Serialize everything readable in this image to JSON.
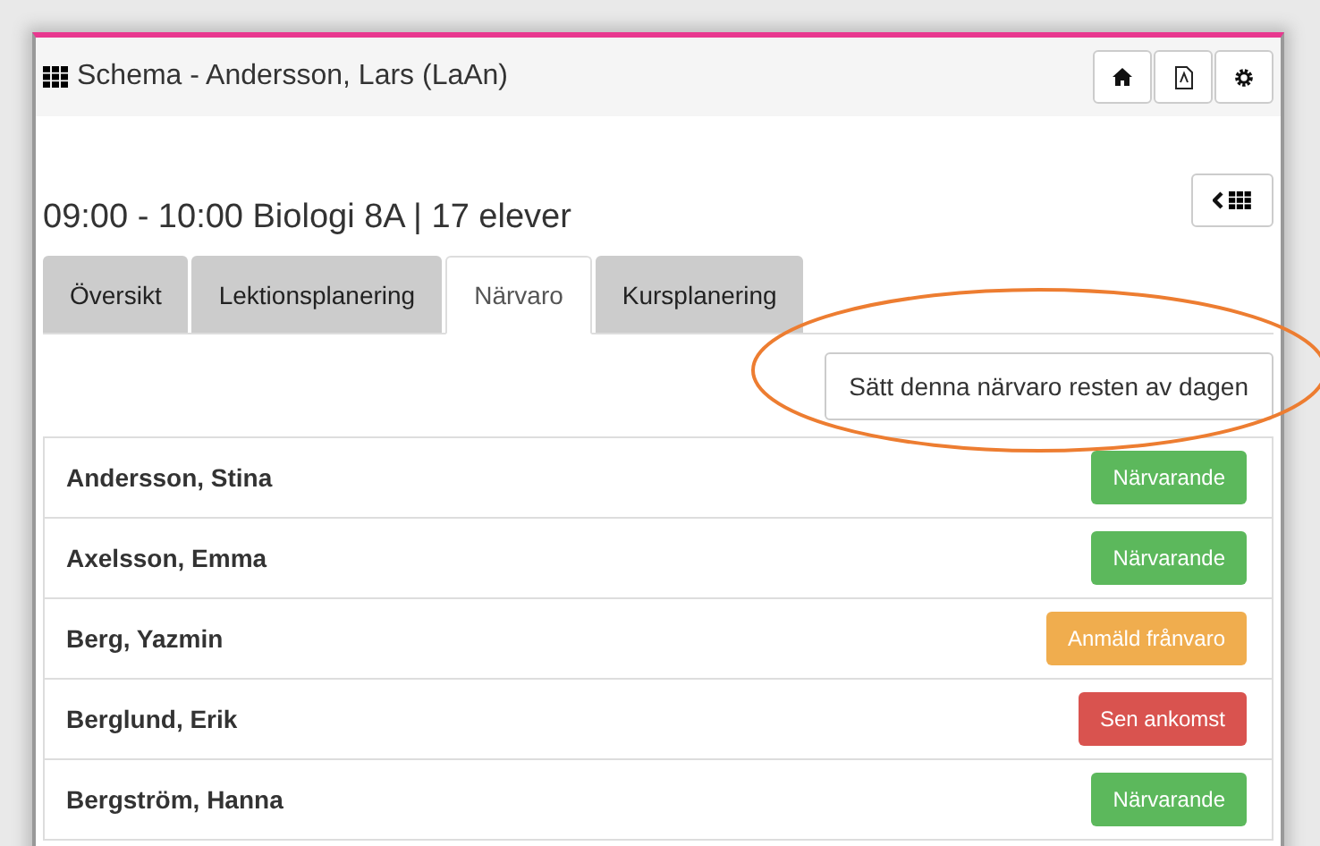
{
  "header": {
    "title": "Schema - Andersson, Lars (LaAn)"
  },
  "lesson": {
    "title": "09:00 - 10:00 Biologi 8A | 17 elever"
  },
  "tabs": [
    {
      "label": "Översikt",
      "selected": false
    },
    {
      "label": "Lektionsplanering",
      "selected": false
    },
    {
      "label": "Närvaro",
      "selected": true
    },
    {
      "label": "Kursplanering",
      "selected": false
    }
  ],
  "set_rest_button": "Sätt denna närvaro resten av dagen",
  "students": [
    {
      "name": "Andersson, Stina",
      "status": "Närvarande",
      "color": "#5cb85c"
    },
    {
      "name": "Axelsson, Emma",
      "status": "Närvarande",
      "color": "#5cb85c"
    },
    {
      "name": "Berg, Yazmin",
      "status": "Anmäld frånvaro",
      "color": "#f0ad4e"
    },
    {
      "name": "Berglund, Erik",
      "status": "Sen ankomst",
      "color": "#d9534f"
    },
    {
      "name": "Bergström, Hanna",
      "status": "Närvarande",
      "color": "#5cb85c"
    }
  ]
}
